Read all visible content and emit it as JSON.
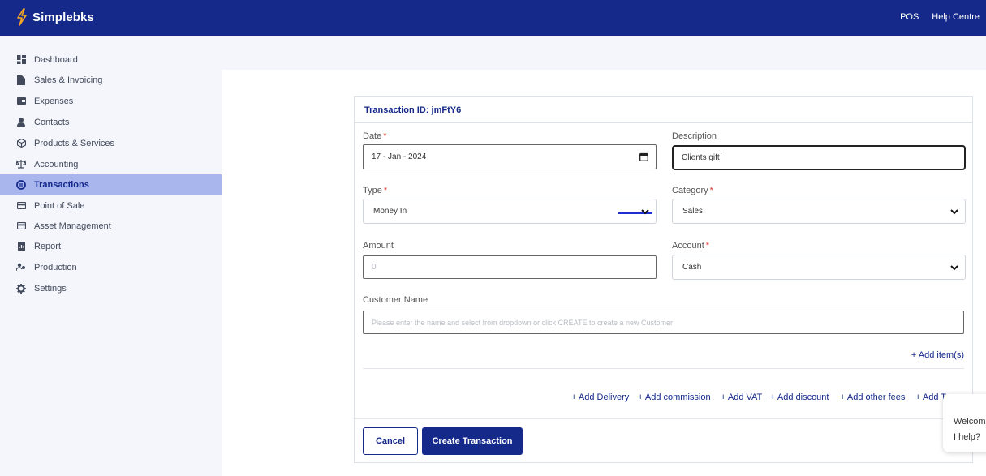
{
  "app": {
    "name": "Simplebks"
  },
  "topnav": {
    "pos": "POS",
    "help": "Help Centre"
  },
  "sidebar": {
    "items": [
      {
        "label": "Dashboard",
        "icon": "dashboard-icon"
      },
      {
        "label": "Sales & Invoicing",
        "icon": "document-icon"
      },
      {
        "label": "Expenses",
        "icon": "wallet-icon"
      },
      {
        "label": "Contacts",
        "icon": "person-icon"
      },
      {
        "label": "Products & Services",
        "icon": "box-icon"
      },
      {
        "label": "Accounting",
        "icon": "scale-icon"
      },
      {
        "label": "Transactions",
        "icon": "transactions-icon",
        "active": true
      },
      {
        "label": "Point of Sale",
        "icon": "card-icon"
      },
      {
        "label": "Asset Management",
        "icon": "card-icon"
      },
      {
        "label": "Report",
        "icon": "report-icon"
      },
      {
        "label": "Production",
        "icon": "people-icon"
      },
      {
        "label": "Settings",
        "icon": "gear-icon"
      }
    ]
  },
  "form": {
    "transaction_id": "Transaction ID: jmFtY6",
    "date": {
      "label": "Date",
      "value": "17 - Jan - 2024"
    },
    "description": {
      "label": "Description",
      "value": "Clients gift"
    },
    "type": {
      "label": "Type",
      "value": "Money In"
    },
    "category": {
      "label": "Category",
      "value": "Sales"
    },
    "amount": {
      "label": "Amount",
      "placeholder": "0"
    },
    "account": {
      "label": "Account",
      "value": "Cash"
    },
    "customer": {
      "label": "Customer Name",
      "placeholder": "Please enter the name and select from dropdown or click CREATE to create a new Customer"
    },
    "required_mark": "*",
    "add_items": "+ Add item(s)",
    "extras": [
      "+ Add Delivery",
      "+ Add commission",
      "+ Add VAT",
      "+ Add discount",
      "+ Add other fees",
      "+ Add T"
    ],
    "cancel": "Cancel",
    "create": "Create Transaction"
  },
  "chat": {
    "line1": "Welcom",
    "line2": "I help?"
  },
  "colors": {
    "brand": "#14298a",
    "active_nav": "#a9b6ee",
    "required": "#dd3333"
  }
}
